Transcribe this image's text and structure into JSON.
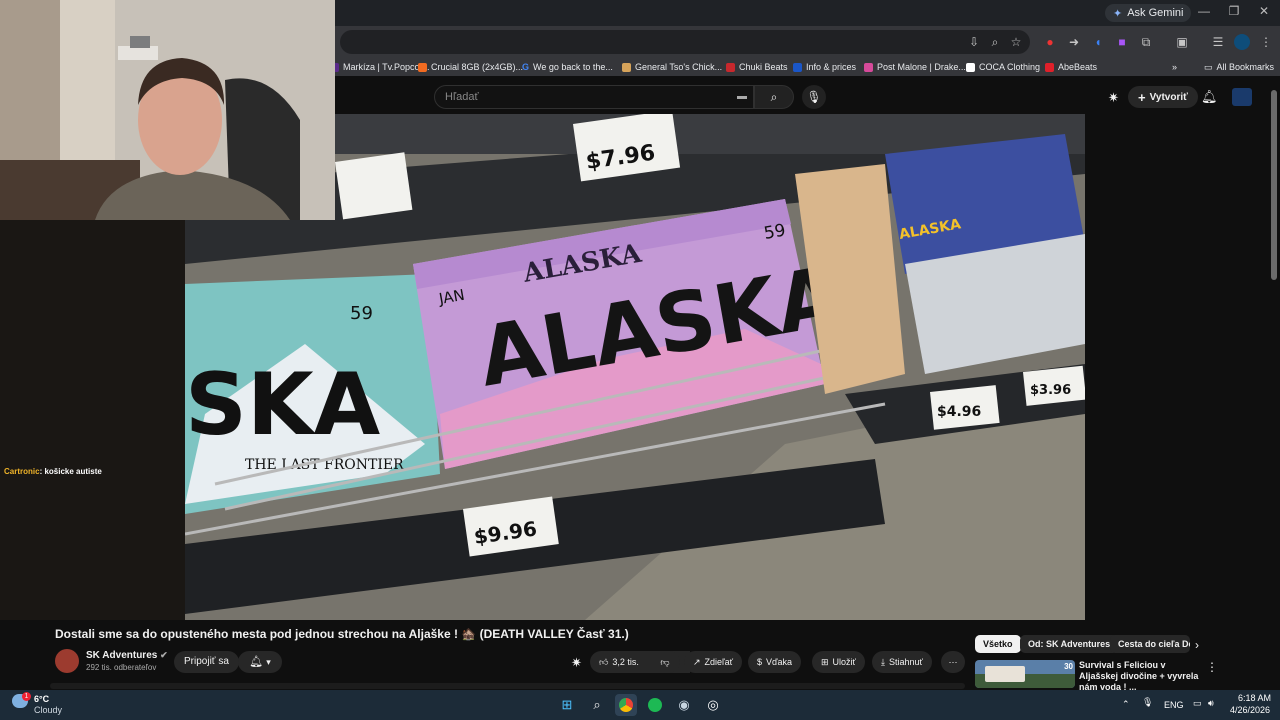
{
  "browser": {
    "ask_gemini": "Ask Gemini",
    "bookmarks": [
      {
        "label": "Markíza | Tv.Popcor...",
        "color": "#5a2a8a"
      },
      {
        "label": "Crucial 8GB (2x4GB)...",
        "color": "#f26b21"
      },
      {
        "label": "We go back to the...",
        "color": "#4285f4"
      },
      {
        "label": "General Tso's Chick...",
        "color": "#d6a35a"
      },
      {
        "label": "Chuki Beats",
        "color": "#c8282d"
      },
      {
        "label": "Info & prices",
        "color": "#1a56c8"
      },
      {
        "label": "Post Malone | Drake...",
        "color": "#d64a9a"
      },
      {
        "label": "COCA Clothing",
        "color": "#ffffff"
      },
      {
        "label": "AbeBeats",
        "color": "#e0202a"
      }
    ],
    "all_bookmarks": "All Bookmarks",
    "more_chevron": "»"
  },
  "youtube": {
    "search_placeholder": "Hľadať",
    "create_label": "Vytvoriť",
    "video_title": "Dostali sme sa do opusteného mesta pod jednou strechou na Aljaške ! 🏚️ (DEATH VALLEY Časť 31.)",
    "channel_name": "SK Adventures",
    "subscribers": "292 tis. odberateľov",
    "join_label": "Pripojiť sa",
    "like_count": "3,2 tis.",
    "share_label": "Zdieľať",
    "thanks_label": "Vďaka",
    "save_label": "Uložiť",
    "download_label": "Stiahnuť",
    "chips": [
      "Všetko",
      "Od: SK Adventures",
      "Cesta do cieľa Do"
    ],
    "recommended": {
      "title": "Survival s Feliciou v Aljašskej divočine + vyvrela nám voda ! ...",
      "duration": "30"
    }
  },
  "video_frame": {
    "plate_text_big": "ALASKA",
    "plate_text_top": "ALASKA",
    "plate_month": "JAN",
    "plate_year": "59",
    "plate_motto": "The Last Frontier",
    "price_1": "$7.96",
    "price_2": "$9.96",
    "price_3": "$4.96",
    "price_4": "$3.96",
    "box_text": "ALASKA"
  },
  "stream_overlay": {
    "chat_user": "Cartronic",
    "chat_message": ": košicke autiste"
  },
  "taskbar": {
    "temperature": "6°C",
    "weather": "Cloudy",
    "weather_badge": "1",
    "lang": "ENG",
    "time": "6:18 AM",
    "date": "4/26/2026"
  }
}
